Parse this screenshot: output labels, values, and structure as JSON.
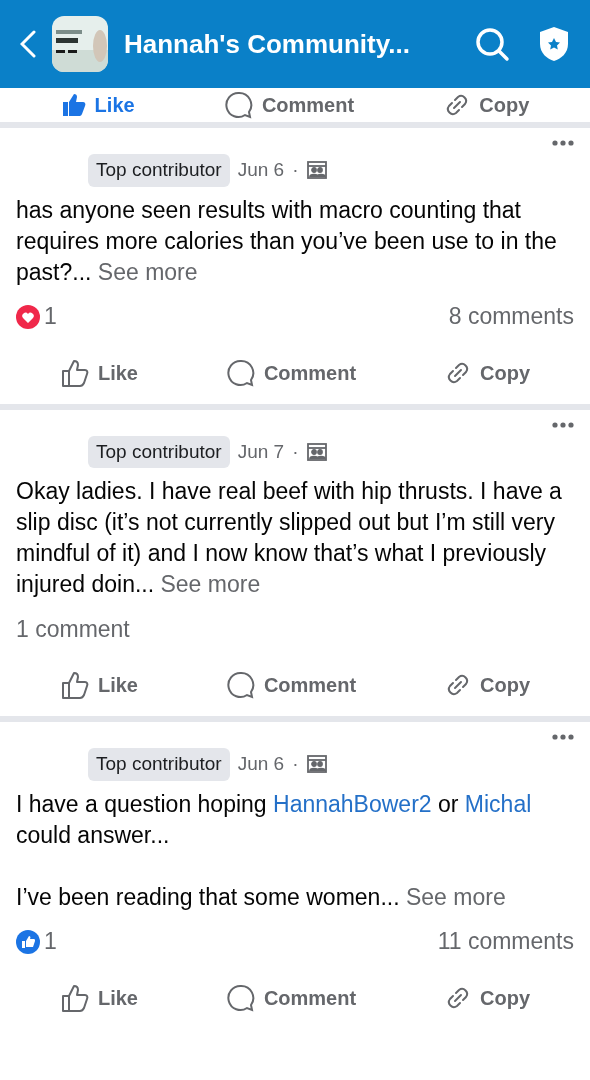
{
  "header": {
    "title": "Hannah's Community..."
  },
  "previous_post": {
    "liked": true,
    "actions": [
      "Like",
      "Comment",
      "Copy"
    ]
  },
  "posts": [
    {
      "badge": "Top contributor",
      "date": "Jun 6",
      "separator": "·",
      "paragraphs": [
        [
          {
            "kind": "text",
            "text": "has anyone seen results with macro counting that requires more calories than you’ve been use to in the past?..."
          },
          {
            "kind": "see_more",
            "text": "See more"
          }
        ]
      ],
      "reaction": {
        "kind": "love",
        "count": "1"
      },
      "comments": "8 comments",
      "liked": false,
      "actions": [
        "Like",
        "Comment",
        "Copy"
      ]
    },
    {
      "badge": "Top contributor",
      "date": "Jun 7",
      "separator": "·",
      "paragraphs": [
        [
          {
            "kind": "text",
            "text": "Okay ladies. I have real beef with hip thrusts. I have a slip disc (it’s not currently slipped out but I’m still very mindful of it) and I now know that’s what I previously injured doin..."
          },
          {
            "kind": "see_more",
            "text": "See more"
          }
        ]
      ],
      "comments": "1 comment",
      "liked": false,
      "actions": [
        "Like",
        "Comment",
        "Copy"
      ]
    },
    {
      "badge": "Top contributor",
      "date": "Jun 6",
      "separator": "·",
      "paragraphs": [
        [
          {
            "kind": "text",
            "text": "I have a question hoping"
          },
          {
            "kind": "mention",
            "text": "HannahBower2"
          },
          {
            "kind": "text",
            "text": "or"
          },
          {
            "kind": "mention",
            "text": "Michal"
          },
          {
            "kind": "text",
            "text": "could answer..."
          }
        ],
        [
          {
            "kind": "text",
            "text": "I’ve been reading that some women..."
          },
          {
            "kind": "see_more",
            "text": "See more"
          }
        ]
      ],
      "reaction": {
        "kind": "like",
        "count": "1"
      },
      "comments": "11 comments",
      "liked": false,
      "actions": [
        "Like",
        "Comment",
        "Copy"
      ]
    }
  ]
}
